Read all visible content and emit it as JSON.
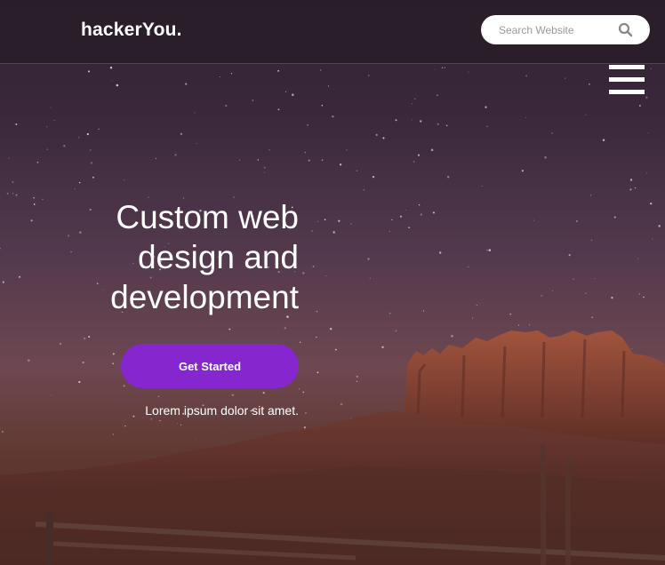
{
  "header": {
    "logo_text": "hackerYou.",
    "search": {
      "placeholder": "Search Website"
    }
  },
  "hero": {
    "headline": "Custom web design and development",
    "cta_label": "Get Started",
    "tagline": "Lorem ipsum dolor sit amet."
  },
  "icons": {
    "search": "search-icon",
    "menu": "hamburger-menu-icon"
  },
  "colors": {
    "accent": "#8526cf",
    "header_overlay": "#2a1f2a",
    "text": "#ffffff"
  }
}
